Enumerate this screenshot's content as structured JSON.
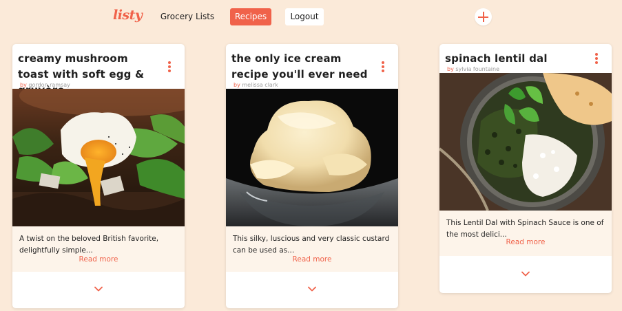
{
  "nav": {
    "logo": "listy",
    "links": [
      {
        "label": "Grocery Lists"
      },
      {
        "label": "Recipes"
      },
      {
        "label": "Logout"
      }
    ],
    "add_icon": "plus-icon"
  },
  "colors": {
    "accent": "#f0624a",
    "background": "#fbead9",
    "card": "#ffffff",
    "card_footer": "#fdf4ea"
  },
  "recipes": [
    {
      "title": "creamy mushroom toast with soft egg & gruyère",
      "by": "by",
      "author": "gordon ramsay",
      "description": "A twist on the beloved British favorite, delightfully simple...",
      "read_more": "Read more",
      "menu_icon": "more-vertical-icon",
      "expand_icon": "chevron-down-icon"
    },
    {
      "title": "the only ice cream recipe you'll ever need",
      "by": "by",
      "author": "melissa clark",
      "description": "This silky, luscious and very classic custard can be used as...",
      "read_more": "Read more",
      "menu_icon": "more-vertical-icon",
      "expand_icon": "chevron-down-icon"
    },
    {
      "title": "spinach lentil dal",
      "by": "by",
      "author": "sylvia fountaine",
      "description": "This Lentil Dal with Spinach Sauce is one of the most delici...",
      "read_more": "Read more",
      "menu_icon": "more-vertical-icon",
      "expand_icon": "chevron-down-icon"
    }
  ]
}
